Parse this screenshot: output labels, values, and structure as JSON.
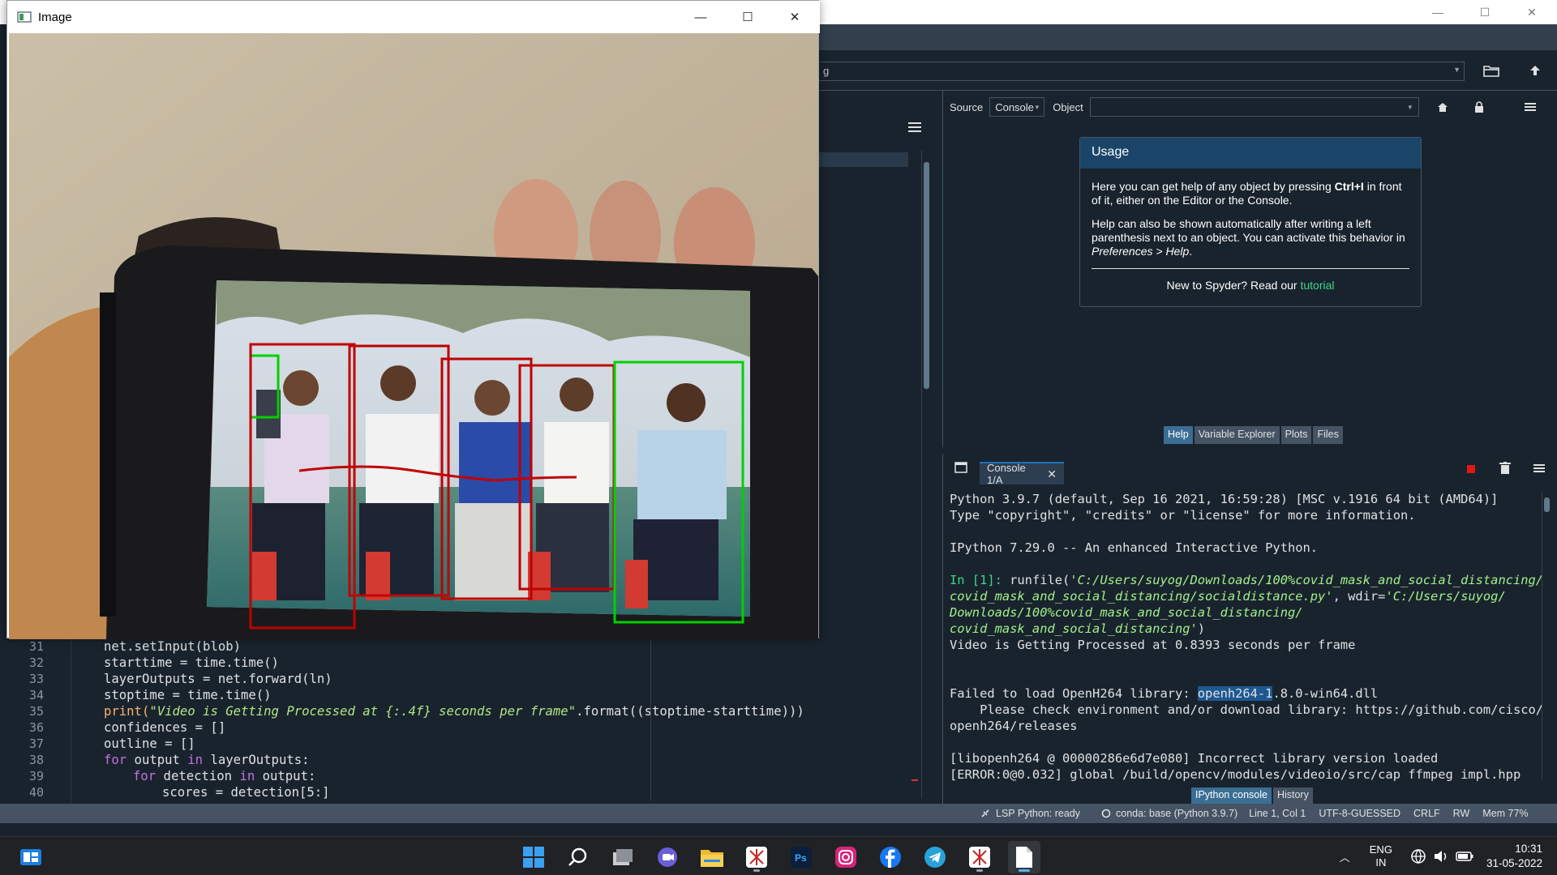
{
  "spyder": {
    "title_controls": [
      "—",
      "☐",
      "✕"
    ],
    "path_fragment": "g",
    "help": {
      "source_label": "Source",
      "source_value": "Console",
      "object_label": "Object",
      "usage_title": "Usage",
      "p1_pre": "Here you can get help of any object by pressing ",
      "p1_key": "Ctrl+I",
      "p1_post": " in front of it, either on the Editor or the Console.",
      "p2_pre": "Help can also be shown automatically after writing a left parenthesis next to an object. You can activate this behavior in ",
      "p2_ital": "Preferences > Help",
      "p2_post": ".",
      "p3_pre": "New to Spyder? Read our ",
      "p3_link": "tutorial",
      "tabs": [
        "Help",
        "Variable Explorer",
        "Plots",
        "Files"
      ],
      "active_tab": "Help"
    },
    "console": {
      "tab_label": "Console 1/A",
      "line1": "Python 3.9.7 (default, Sep 16 2021, 16:59:28) [MSC v.1916 64 bit (AMD64)]",
      "line2": "Type \"copyright\", \"credits\" or \"license\" for more information.",
      "line3": "IPython 7.29.0 -- An enhanced Interactive Python.",
      "prompt": "In [1]:",
      "run_fn": " runfile(",
      "run_str1": "'C:/Users/suyog/Downloads/100%covid_mask_and_social_distancing/",
      "run_str2": "covid_mask_and_social_distancing/socialdistance.py'",
      "run_mid": ", wdir=",
      "run_str3": "'C:/Users/suyog/",
      "run_str4": "Downloads/100%covid_mask_and_social_distancing/",
      "run_str5": "covid_mask_and_social_distancing'",
      "run_end": ")",
      "line_video": "Video is Getting Processed at 0.8393 seconds per frame",
      "fail_pre": "Failed to load OpenH264 library: ",
      "fail_sel": "openh264-1",
      "fail_post": ".8.0-win64.dll",
      "check1": "    Please check environment and/or download library: https://github.com/cisco/",
      "check2": "openh264/releases",
      "lib_line": "[libopenh264 @ 00000286e6d7e080] Incorrect library version loaded",
      "err_line": "[ERROR:0@0.032] global /build/opencv/modules/videoio/src/cap_ffmpeg_impl.hpp",
      "tabs": [
        "IPython console",
        "History"
      ],
      "active_tab": "IPython console"
    },
    "editor": {
      "line_numbers": [
        "31",
        "32",
        "33",
        "34",
        "35",
        "36",
        "37",
        "38",
        "39",
        "40"
      ],
      "l31": "net.setInput(blob)",
      "l32": "starttime = time.time()",
      "l33": "layerOutputs = net.forward(ln)",
      "l34": "stoptime = time.time()",
      "l35_fn": "print(",
      "l35_str": "\"Video is Getting Processed at {:.4f} seconds per frame\"",
      "l35_rest": ".format((stoptime-starttime)))",
      "l36": "confidences = []",
      "l37": "outline = []",
      "l38_kw1": "for",
      "l38_mid": " output ",
      "l38_kw2": "in",
      "l38_rest": " layerOutputs:",
      "l39_kw1": "for",
      "l39_mid": " detection ",
      "l39_kw2": "in",
      "l39_rest": " output:",
      "l40": "scores = detection[5:]"
    },
    "status": {
      "lsp": "LSP Python: ready",
      "conda": "conda: base (Python 3.9.7)",
      "position": "Line 1, Col 1",
      "encoding": "UTF-8-GUESSED",
      "eol": "CRLF",
      "rw": "RW",
      "mem": "Mem 77%"
    }
  },
  "image_window": {
    "title": "Image",
    "controls": [
      "—",
      "☐",
      "✕"
    ],
    "boxes": [
      {
        "color": "#00d000",
        "label": "safe"
      },
      {
        "color": "#c00000",
        "label": "violation"
      },
      {
        "color": "#c00000",
        "label": "violation"
      },
      {
        "color": "#c00000",
        "label": "violation"
      },
      {
        "color": "#c00000",
        "label": "violation"
      },
      {
        "color": "#00d000",
        "label": "safe"
      }
    ]
  },
  "taskbar": {
    "icons": [
      "widgets-icon",
      "start-icon",
      "search-icon",
      "task-view-icon",
      "chat-icon",
      "file-explorer-icon",
      "app-icon",
      "photoshop-icon",
      "instagram-icon",
      "facebook-icon",
      "telegram-icon",
      "app-icon-2",
      "file-icon"
    ],
    "lang1": "ENG",
    "lang2": "IN",
    "time": "10:31",
    "date": "31-05-2022"
  },
  "colors": {
    "spyder_bg": "#19232d",
    "accent": "#1a72bb",
    "prompt": "#3cd78a",
    "keyword": "#c670e0",
    "string": "#b0e686",
    "safe_box": "#00d000",
    "violation_box": "#c00000"
  }
}
